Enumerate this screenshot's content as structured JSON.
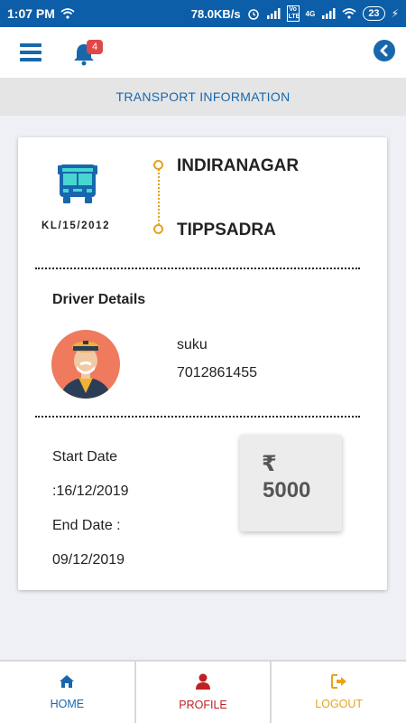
{
  "status_bar": {
    "time": "1:07 PM",
    "speed": "78.0KB/s",
    "volte_label": "Vo LTE",
    "network": "4G",
    "battery": "23"
  },
  "header": {
    "notification_count": "4"
  },
  "section": {
    "title": "TRANSPORT INFORMATION"
  },
  "vehicle": {
    "plate": "KL/15/2012",
    "route_from": "INDIRANAGAR",
    "route_to": "TIPPSADRA"
  },
  "driver": {
    "heading": "Driver Details",
    "name": "suku",
    "phone": "7012861455"
  },
  "dates": {
    "start_label": "Start Date",
    "start_value": ":16/12/2019",
    "end_label": "End Date :",
    "end_value": "09/12/2019"
  },
  "fee": {
    "currency": "₹",
    "amount": "5000"
  },
  "bottom_nav": {
    "home": "HOME",
    "profile": "PROFILE",
    "logout": "LOGOUT"
  },
  "colors": {
    "primary": "#1767ad",
    "route_accent": "#e4a21f",
    "profile": "#c02025",
    "logout": "#e8a41c"
  }
}
